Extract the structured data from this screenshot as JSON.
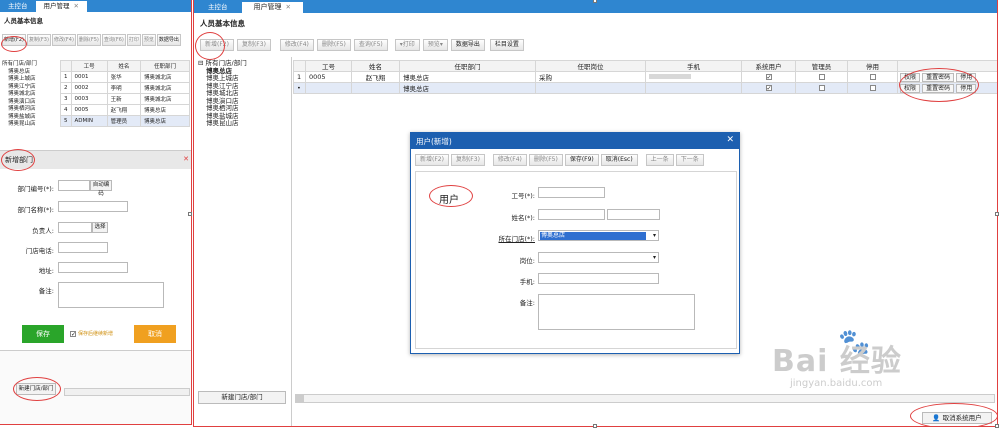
{
  "left": {
    "tabs": [
      "主控台",
      "用户管理"
    ],
    "title": "人员基本信息",
    "toolbar": [
      "新增(F2)",
      "复制(F3)",
      "修改(F4)",
      "删除(F5)",
      "查询(F6)",
      "打印",
      "预览",
      "数据导出"
    ],
    "tree_root": "所有门店/部门",
    "tree_items": [
      "博奥总店",
      "博奥上城店",
      "博奥江宁店",
      "博奥城北店",
      "博奥演口店",
      "博奥栖河店",
      "博奥盐城店",
      "博奥昆山店"
    ],
    "table_headers": [
      "",
      "工号",
      "姓名",
      "任职部门"
    ],
    "rows": [
      [
        "1",
        "0001",
        "张华",
        "博奥城北店"
      ],
      [
        "2",
        "0002",
        "李明",
        "博奥城北店"
      ],
      [
        "3",
        "0003",
        "王新",
        "博奥城北店"
      ],
      [
        "4",
        "0005",
        "赵飞翔",
        "博奥总店"
      ],
      [
        "5",
        "ADMIN",
        "管理员",
        "博奥总店"
      ]
    ],
    "dialog_title": "新增部门",
    "form_labels": [
      "部门编号(*):",
      "部门名称(*):",
      "负责人:",
      "门店电话:",
      "地址:",
      "备注:"
    ],
    "auto_code_label": "自动编码",
    "select_label": "选择",
    "save_label": "保存",
    "cancel_label": "取消",
    "continue_label": "保存后继续新增",
    "new_store_label": "新建门店/部门"
  },
  "main": {
    "tabs": [
      "主控台",
      "用户管理"
    ],
    "title": "人员基本信息",
    "toolbar": [
      "新增(F2)",
      "复制(F3)",
      "修改(F4)",
      "删除(F5)",
      "查询(F5)",
      "打印",
      "预览",
      "数据导出",
      "栏目设置"
    ],
    "tree_root": "所有门店/部门",
    "tree_items": [
      "博奥总店",
      "博奥上城店",
      "博奥江宁店",
      "博奥城北店",
      "博奥演口店",
      "博奥栖河店",
      "博奥盐城店",
      "博奥昆山店"
    ],
    "table_headers": [
      "",
      "工号",
      "姓名",
      "任职部门",
      "任职岗位",
      "手机",
      "系统用户",
      "管理员",
      "停用",
      ""
    ],
    "rows": [
      {
        "idx": "1",
        "code": "0005",
        "name": "赵飞翔",
        "dept": "博奥总店",
        "post": "采购",
        "phone": "",
        "sys": true,
        "admin": false,
        "off": false
      },
      {
        "idx": "•",
        "code": "",
        "name": "",
        "dept": "博奥总店",
        "post": "",
        "phone": "",
        "sys": true,
        "admin": false,
        "off": false
      }
    ],
    "row_actions": [
      "权限",
      "重置密码",
      "停用"
    ],
    "new_store_label": "新建门店/部门",
    "cancel_sys_user": "取消系统用户"
  },
  "dialog": {
    "title": "用户(新增)",
    "toolbar": [
      "新增(F2)",
      "复制(F3)",
      "修改(F4)",
      "删除(F5)",
      "保存(F9)",
      "取消(Esc)",
      "上一条",
      "下一条"
    ],
    "heading": "用户",
    "labels": {
      "code": "工号(*):",
      "name": "姓名(*):",
      "store": "所在门店(*):",
      "post": "岗位:",
      "phone": "手机:",
      "note": "备注:"
    },
    "store_value": "博奥总店"
  },
  "watermark": {
    "brand": "Bai 经验",
    "url": "jingyan.baidu.com"
  },
  "colors": {
    "accent": "#2f86d0",
    "save_green": "#2aa52a",
    "cancel_orange": "#f0a020",
    "dialog_header": "#1c5fb0",
    "oval": "#e04040"
  }
}
